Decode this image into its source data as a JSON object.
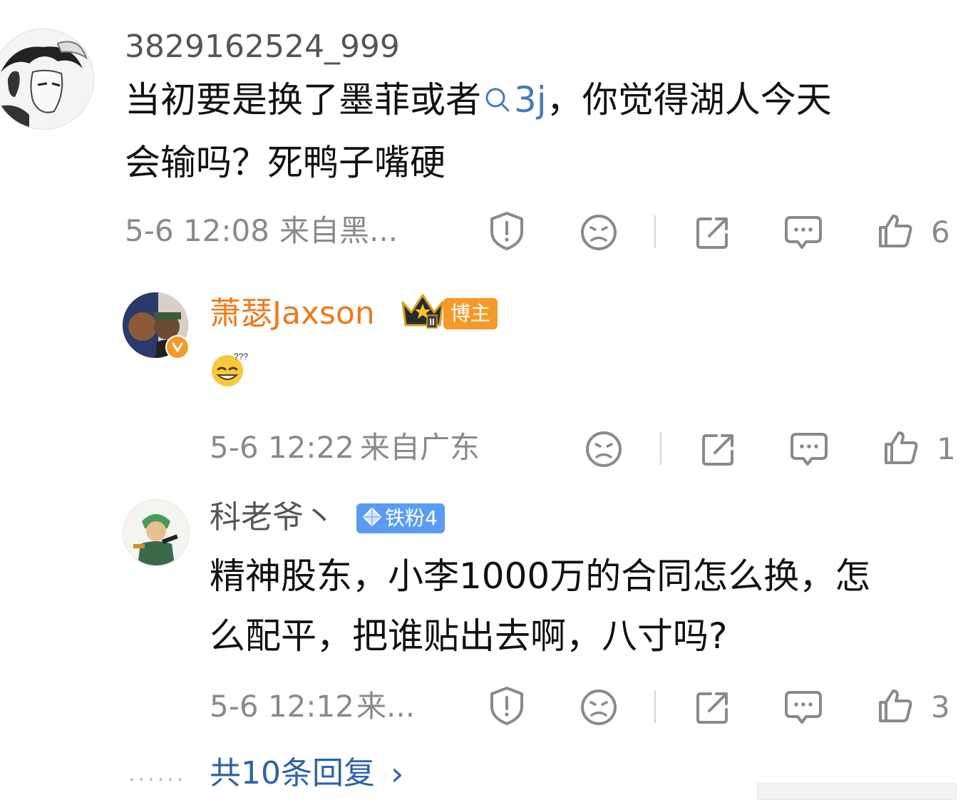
{
  "comments": [
    {
      "username": "3829162524_999",
      "text_before": "当初要是换了墨菲或者",
      "topic": "3j",
      "text_line1_after": "，你觉得湖人今天",
      "text_line2": "会输吗？死鸭子嘴硬",
      "time": "5-6 12:08",
      "location": "来自黑...",
      "like_count": "6"
    },
    {
      "username": "萧瑟Jaxson",
      "badge": "博主",
      "badge_level": "II",
      "time": "5-6 12:22",
      "location": "来自广东",
      "like_count": "1"
    },
    {
      "username": "科老爷丶",
      "badge": "铁粉4",
      "text_line1": "精神股东，小李1000万的合同怎么换，怎",
      "text_line2": "么配平，把谁贴出去啊，八寸吗?",
      "time": "5-6 12:12",
      "location": "来...",
      "like_count": "3"
    }
  ],
  "footer": {
    "ellipsis": "......",
    "more_replies": "共10条回复",
    "chevron": "›"
  },
  "icons": [
    "report-icon",
    "dislike-icon",
    "share-icon",
    "comment-icon",
    "like-icon",
    "avatar-verified-icon",
    "crown-icon",
    "diamond-icon",
    "emoji-icon"
  ],
  "colors": {
    "orange_name": "#f07a1a",
    "topic_blue": "#4a7bb8",
    "link_blue": "#2f62a8",
    "badge_orange": "#f59a2a",
    "badge_blue": "#5b9cf3"
  }
}
